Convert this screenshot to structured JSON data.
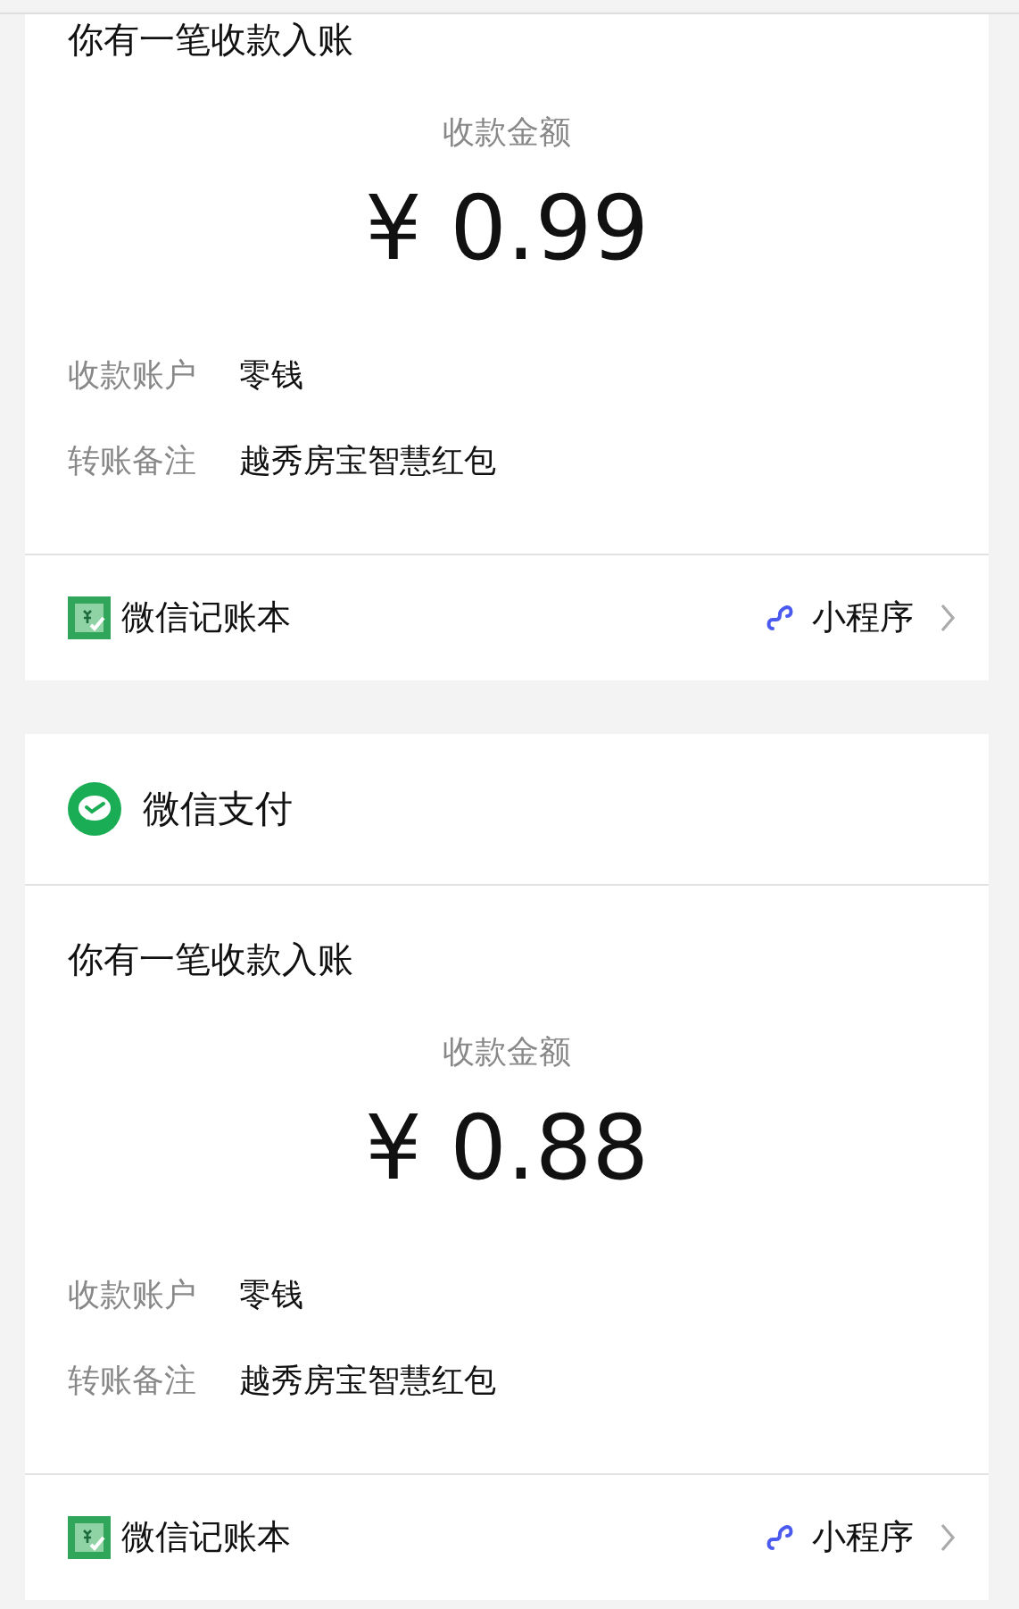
{
  "messages": [
    {
      "title": "你有一笔收款入账",
      "amount_label": "收款金额",
      "amount": "¥ 0.99",
      "fields": [
        {
          "label": "收款账户",
          "value": "零钱"
        },
        {
          "label": "转账备注",
          "value": "越秀房宝智慧红包"
        }
      ],
      "footer": {
        "app": "微信记账本",
        "link": "小程序"
      }
    },
    {
      "header": {
        "title": "微信支付"
      },
      "title": "你有一笔收款入账",
      "amount_label": "收款金额",
      "amount": "¥ 0.88",
      "fields": [
        {
          "label": "收款账户",
          "value": "零钱"
        },
        {
          "label": "转账备注",
          "value": "越秀房宝智慧红包"
        }
      ],
      "footer": {
        "app": "微信记账本",
        "link": "小程序"
      }
    }
  ]
}
